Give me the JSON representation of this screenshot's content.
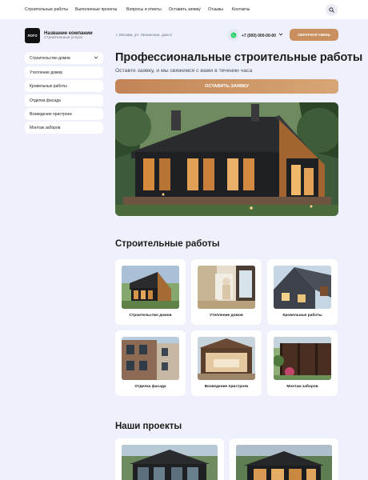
{
  "nav": {
    "links": [
      "Строительные работы",
      "Выполненые проекты",
      "Вопросы и ответы",
      "Оставить заявку",
      "Отзывы",
      "Контакты"
    ]
  },
  "header": {
    "logo_text": "ЛОГО",
    "company_name": "Название компании",
    "company_sub": "Строительные услуги",
    "address": "г. Москва, ул. Ленинская, дом 0",
    "phone": "+7 (000) 000-00-00",
    "callback_label": "ОБРАТНАЯ СВЯЗЬ"
  },
  "sidebar": {
    "items": [
      {
        "label": "Строительство домов"
      },
      {
        "label": "Утепление домов"
      },
      {
        "label": "Кровельные работы"
      },
      {
        "label": "Отделка фасада"
      },
      {
        "label": "Возведение пристроек"
      },
      {
        "label": "Монтаж заборов"
      }
    ]
  },
  "hero": {
    "title": "Профессиональные строительные работы",
    "subtitle": "Оставте заявку, и мы свяжемся с вами в течении часа",
    "button_label": "ОСТАВИТЬ ЗАЯВКУ"
  },
  "works": {
    "title": "Строительные работы",
    "cards": [
      {
        "label": "Строительство домов"
      },
      {
        "label": "Утепление домов"
      },
      {
        "label": "Кровельные работы"
      },
      {
        "label": "Отделка фасада"
      },
      {
        "label": "Возведение пристроек"
      },
      {
        "label": "Монтаж заборов"
      }
    ]
  },
  "projects": {
    "title": "Наши проекты"
  },
  "colors": {
    "accent": "#c98f5f",
    "background": "#eef1fb",
    "whatsapp": "#25d366"
  }
}
